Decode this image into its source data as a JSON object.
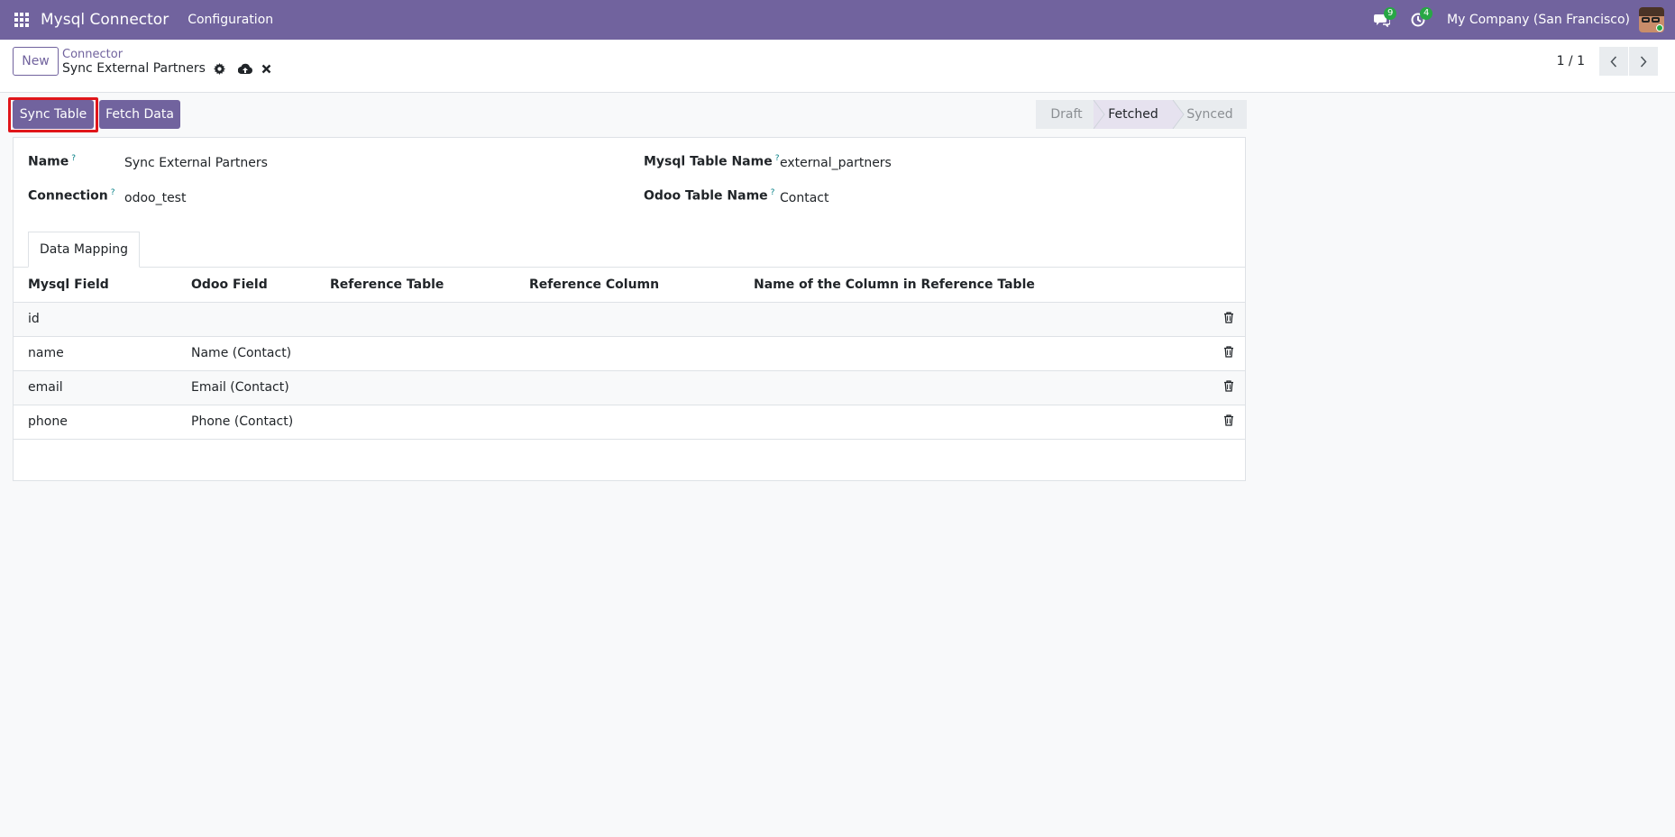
{
  "navbar": {
    "app_name": "Mysql Connector",
    "menu": [
      "Configuration"
    ],
    "messages_count": "9",
    "activities_count": "4",
    "company": "My Company (San Francisco)"
  },
  "control_panel": {
    "new_label": "New",
    "breadcrumb_parent": "Connector",
    "breadcrumb_current": "Sync External Partners",
    "pager": "1 / 1"
  },
  "statusbar": {
    "sync_table_label": "Sync Table",
    "fetch_data_label": "Fetch Data",
    "stages": [
      "Draft",
      "Fetched",
      "Synced"
    ],
    "active_stage": "Fetched"
  },
  "form": {
    "name_label": "Name",
    "name_value": "Sync External Partners",
    "connection_label": "Connection",
    "connection_value": "odoo_test",
    "mysql_table_label": "Mysql Table Name",
    "mysql_table_value": "external_partners",
    "odoo_table_label": "Odoo Table Name",
    "odoo_table_value": "Contact",
    "help_mark": "?"
  },
  "tabs": {
    "data_mapping": "Data Mapping"
  },
  "mapping_table": {
    "columns": [
      "Mysql Field",
      "Odoo Field",
      "Reference Table",
      "Reference Column",
      "Name of the Column in Reference Table"
    ],
    "rows": [
      {
        "mysql_field": "id",
        "odoo_field": "",
        "reference_table": "",
        "reference_column": "",
        "ref_col_name": ""
      },
      {
        "mysql_field": "name",
        "odoo_field": "Name (Contact)",
        "reference_table": "",
        "reference_column": "",
        "ref_col_name": ""
      },
      {
        "mysql_field": "email",
        "odoo_field": "Email (Contact)",
        "reference_table": "",
        "reference_column": "",
        "ref_col_name": ""
      },
      {
        "mysql_field": "phone",
        "odoo_field": "Phone (Contact)",
        "reference_table": "",
        "reference_column": "",
        "ref_col_name": ""
      }
    ]
  },
  "colors": {
    "brand": "#71639e",
    "highlight": "#e0161a",
    "badge": "#28a745"
  }
}
